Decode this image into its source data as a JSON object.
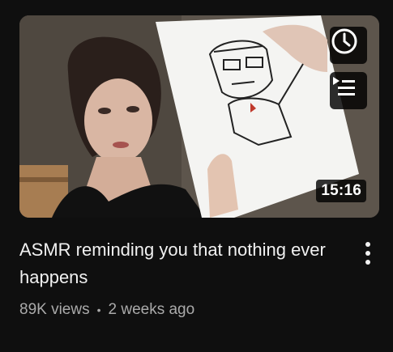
{
  "video": {
    "title": "ASMR reminding you that nothing ever happens",
    "views": "89K views",
    "separator": "•",
    "uploaded": "2 weeks ago",
    "duration": "15:16"
  },
  "icons": {
    "watch_later": "clock-icon",
    "add_to_queue": "queue-icon",
    "more": "vertical-dots-icon"
  },
  "colors": {
    "background": "#0f0f0f",
    "title": "#f1f1f1",
    "meta": "#aaaaaa"
  }
}
